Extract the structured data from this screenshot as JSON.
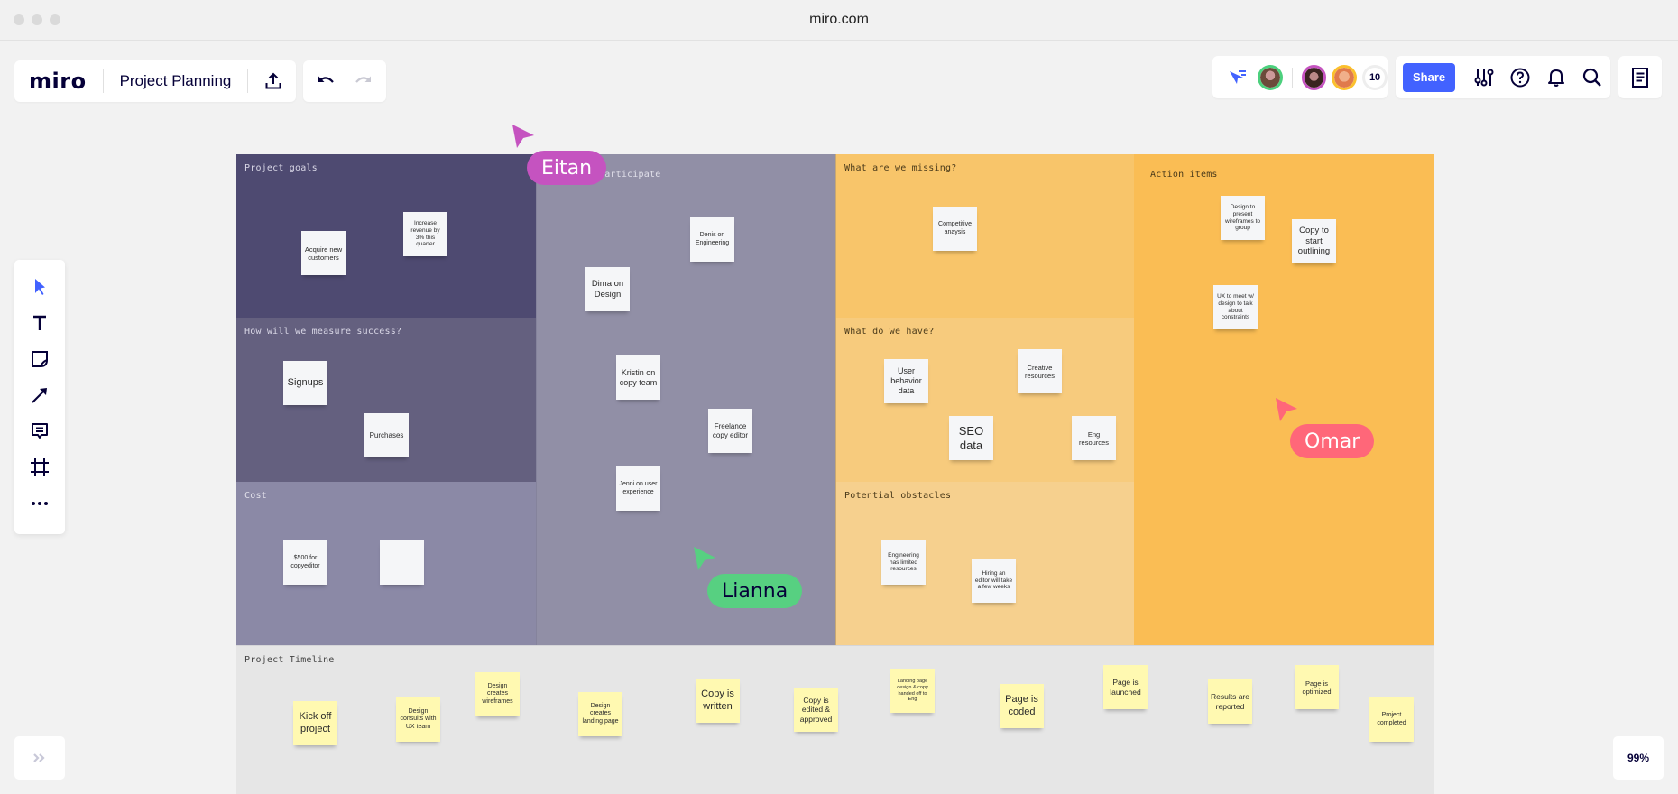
{
  "browser": {
    "url": "miro.com"
  },
  "header": {
    "logo": "miro",
    "board_title": "Project Planning",
    "share_label": "Share",
    "collaborator_count": "10",
    "icons": [
      "upload-icon",
      "undo-icon",
      "redo-icon",
      "presenter-cursor-icon",
      "settings-sliders-icon",
      "help-icon",
      "notifications-bell-icon",
      "search-icon",
      "notes-list-icon"
    ]
  },
  "collaborators": [
    {
      "name": "Collaborator 1",
      "ring": "#4cd07d",
      "skin": "#6b4a3a"
    },
    {
      "name": "Collaborator 2",
      "ring": "#c553c0",
      "skin": "#4a2e2a"
    },
    {
      "name": "Collaborator 3",
      "ring": "#fbc02d",
      "skin": "#e08a5c"
    }
  ],
  "toolbar": {
    "tools": [
      "select",
      "text",
      "sticky-note",
      "arrow-line",
      "comment",
      "frame",
      "more"
    ]
  },
  "sections": [
    {
      "id": "project-goals",
      "label": "Project goals",
      "color": "#4e4a71",
      "label_color": "#d9d7e6"
    },
    {
      "id": "who-will-participate",
      "label": "Who will participate",
      "color": "#918fa6",
      "label_color": "#e1e0ea"
    },
    {
      "id": "measure-success",
      "label": "How will we measure success?",
      "color": "#64607f",
      "label_color": "#d9d7e6"
    },
    {
      "id": "cost",
      "label": "Cost",
      "color": "#8b89a6",
      "label_color": "#e1e0ea"
    },
    {
      "id": "what-missing",
      "label": "What are we missing?",
      "color": "#f8c56a",
      "label_color": "#4a3a1a"
    },
    {
      "id": "what-have",
      "label": "What do we have?",
      "color": "#f7cb7d",
      "label_color": "#4a3a1a"
    },
    {
      "id": "obstacles",
      "label": "Potential obstacles",
      "color": "#f6d08e",
      "label_color": "#4a3a1a"
    },
    {
      "id": "action-items",
      "label": "Action items",
      "color": "#fabd54",
      "label_color": "#4a3a1a"
    },
    {
      "id": "timeline",
      "label": "Project Timeline",
      "color": "#e6e6e6",
      "label_color": "#444444"
    }
  ],
  "stickies": {
    "project_goals": [
      "Acquire new customers",
      "Increase revenue by 3% this quarter"
    ],
    "who_will_participate": [
      "Dima on Design",
      "Denis on Engineering",
      "Kristin on copy team",
      "Freelance copy editor",
      "Jenni on user experience"
    ],
    "measure_success": [
      "Signups",
      "Purchases"
    ],
    "cost": [
      "$500 for copyeditor",
      ""
    ],
    "what_missing": [
      "Competitive anaysis"
    ],
    "what_have": [
      "User behavior data",
      "Creative resources",
      "SEO data",
      "Eng resources"
    ],
    "obstacles": [
      "Engineering has limited resources",
      "Hiring an editor will take a few weeks"
    ],
    "action_items": [
      "Design to present wireframes to group",
      "Copy to start outlining",
      "UX to meet w/ design to talk about constraints"
    ],
    "timeline": [
      "Kick off project",
      "Design consults with UX team",
      "Design creates wireframes",
      "Design creates landing page",
      "Copy is written",
      "Copy is edited & approved",
      "Landing page design & copy handed off to Eng",
      "Page is coded",
      "Page is launched",
      "Results are reported",
      "Page is optimized",
      "Project completed"
    ]
  },
  "cursors": [
    {
      "name": "Eitan",
      "color": "#c553c0",
      "text_color": "#ffffff"
    },
    {
      "name": "Lianna",
      "color": "#57d081",
      "text_color": "#050038"
    },
    {
      "name": "Omar",
      "color": "#ff6779",
      "text_color": "#ffffff"
    }
  ],
  "footer": {
    "zoom_level": "99%",
    "expand_icon": "double-chevron-right-icon"
  }
}
